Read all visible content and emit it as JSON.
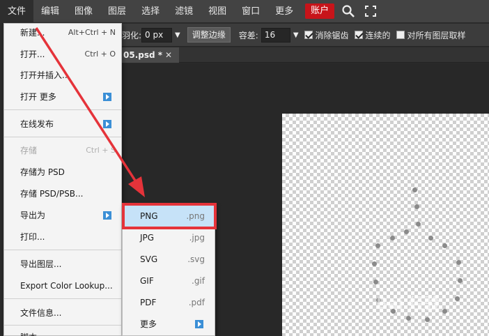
{
  "menubar": {
    "items": [
      "文件",
      "编辑",
      "图像",
      "图层",
      "选择",
      "滤镜",
      "视图",
      "窗口",
      "更多"
    ],
    "account_label": "账户",
    "icons": [
      "search-icon",
      "fullscreen-icon"
    ]
  },
  "options": {
    "feather_label": "羽化:",
    "feather_value": "0 px",
    "refine_edge_label": "调整边缘",
    "tolerance_label": "容差:",
    "tolerance_value": "16",
    "antialias_label": "消除锯齿",
    "antialias_checked": true,
    "contiguous_label": "连续的",
    "contiguous_checked": true,
    "sample_all_label": "对所有图层取样",
    "sample_all_checked": false
  },
  "tab": {
    "title": "05.psd *",
    "close": "✕"
  },
  "file_menu": {
    "items": [
      {
        "label": "新建...",
        "shortcut": "Alt+Ctrl + N"
      },
      {
        "label": "打开...",
        "shortcut": "Ctrl + O"
      },
      {
        "label": "打开并插入..."
      },
      {
        "label": "打开 更多",
        "submenu": true
      },
      {
        "label": "在线发布",
        "submenu": true
      },
      {
        "label": "存储",
        "shortcut": "Ctrl + S",
        "disabled": true
      },
      {
        "label": "存储为 PSD"
      },
      {
        "label": "存储 PSD/PSB..."
      },
      {
        "label": "导出为",
        "submenu": true
      },
      {
        "label": "打印..."
      },
      {
        "label": "导出图层..."
      },
      {
        "label": "Export Color Lookup..."
      },
      {
        "label": "文件信息..."
      },
      {
        "label": "脚本"
      }
    ]
  },
  "export_menu": {
    "items": [
      {
        "name": "PNG",
        "ext": ".png",
        "selected": true
      },
      {
        "name": "JPG",
        "ext": ".jpg"
      },
      {
        "name": "SVG",
        "ext": ".svg"
      },
      {
        "name": "GIF",
        "ext": ".gif"
      },
      {
        "name": "PDF",
        "ext": ".pdf"
      },
      {
        "name": "更多",
        "submenu": true
      }
    ]
  },
  "annotation": {
    "highlight_color": "#e5333a"
  },
  "watermark": {
    "text": "Bai 经验"
  },
  "colors": {
    "account_bg": "#c8141a",
    "submenu_arrow": "#3b8fd6",
    "selected_row": "#c6e2f8"
  }
}
